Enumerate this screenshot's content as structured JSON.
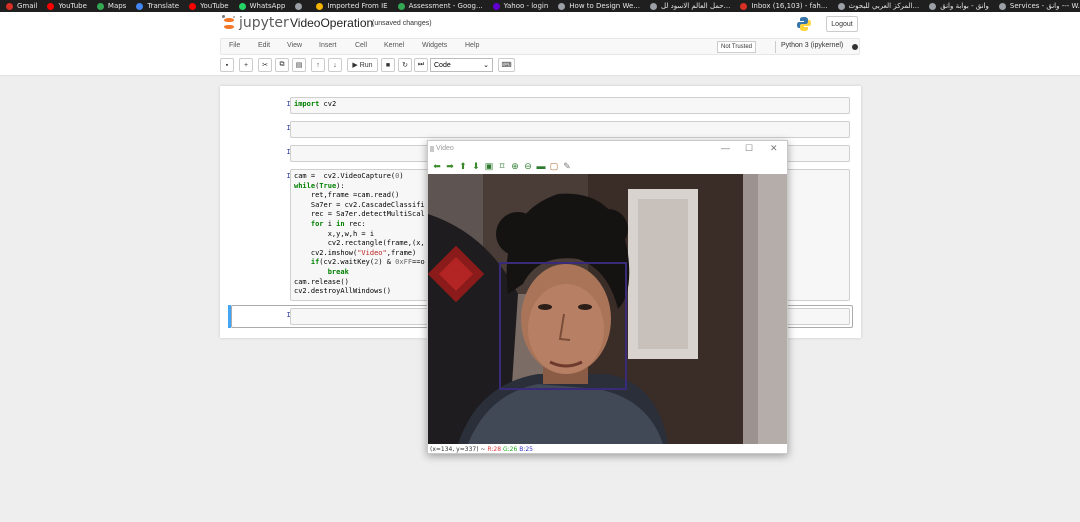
{
  "bookmarks": [
    {
      "label": "Gmail",
      "color": "#d93025"
    },
    {
      "label": "YouTube",
      "color": "#ff0000"
    },
    {
      "label": "Maps",
      "color": "#34a853"
    },
    {
      "label": "Translate",
      "color": "#4285f4"
    },
    {
      "label": "YouTube",
      "color": "#ff0000"
    },
    {
      "label": "WhatsApp",
      "color": "#25d366"
    },
    {
      "label": "",
      "color": "#9aa0a6"
    },
    {
      "label": "Imported From IE",
      "color": "#f4b400"
    },
    {
      "label": "Assessment - Goog...",
      "color": "#34a853"
    },
    {
      "label": "Yahoo - login",
      "color": "#6001d2"
    },
    {
      "label": "How to Design We...",
      "color": "#9aa0a6"
    },
    {
      "label": "حمل العالم الاسود لل...",
      "color": "#9aa0a6"
    },
    {
      "label": "Inbox (16,103) - fah...",
      "color": "#d93025"
    },
    {
      "label": "المركز العربي للبحوث...",
      "color": "#9aa0a6"
    },
    {
      "label": "وانق - بوابة وانق",
      "color": "#9aa0a6"
    },
    {
      "label": "Services - وانق --- W...",
      "color": "#9aa0a6"
    }
  ],
  "header": {
    "logo_text": "jupyter",
    "notebook_name": "VideoOperation",
    "save_status": "(unsaved changes)",
    "logout_label": "Logout"
  },
  "menu": {
    "items": [
      "File",
      "Edit",
      "View",
      "Insert",
      "Cell",
      "Kernel",
      "Widgets",
      "Help"
    ],
    "trust_label": "Not Trusted",
    "kernel_name": "Python 3 (ipykernel)"
  },
  "toolbar": {
    "run_label": "Run",
    "cell_type": "Code"
  },
  "cells": [
    {
      "prompt": "In [1]:",
      "code": "import cv2"
    },
    {
      "prompt": "In [ ]:",
      "code": ""
    },
    {
      "prompt": "In [ ]:",
      "code": ""
    },
    {
      "prompt": "In [*]:",
      "code": "cam =  cv2.VideoCapture(0)\nwhile(True):\n    ret,frame =cam.read()\n    Sa7er = cv2.CascadeClassifi\n    rec = Sa7er.detectMultiScal\n    for i in rec:\n        x,y,w,h = i\n        cv2.rectangle(frame,(x,\n    cv2.imshow(\"Video\",frame)\n    if(cv2.waitKey(2) & 0xFF==o\n        break\ncam.release()\ncv2.destroyAllWindows()"
    },
    {
      "prompt": "In [ ]:",
      "code": ""
    }
  ],
  "video_window": {
    "title": "Video",
    "minimize": "—",
    "maximize": "☐",
    "close": "✕",
    "status_coords": "(x=134, y=337) ~",
    "status_r": "R:28",
    "status_g": "G:26",
    "status_b": "B:25"
  },
  "colors": {
    "selected_cell": "#42a5f5",
    "prompt": "#303f9f",
    "detection_box": "#3a2a7a"
  }
}
